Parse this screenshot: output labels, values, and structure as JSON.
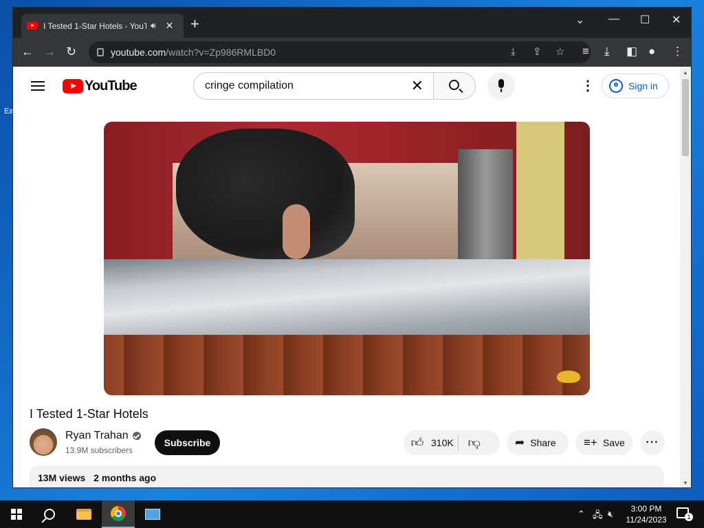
{
  "browser": {
    "tab_title": "I Tested 1-Star Hotels - YouT",
    "audio_icon": "speaker-icon",
    "close_tab": "✕",
    "new_tab": "+",
    "url_host": "youtube.com",
    "url_path": "/watch?v=Zp986RMLBD0"
  },
  "youtube": {
    "logo_text": "YouTube",
    "search_query": "cringe compilation",
    "sign_in": "Sign in",
    "video_title": "I Tested 1-Star Hotels",
    "channel_name": "Ryan Trahan",
    "subscribers": "13.9M subscribers",
    "subscribe": "Subscribe",
    "likes": "310K",
    "share": "Share",
    "save": "Save",
    "views": "13M views",
    "uploaded": "2 months ago"
  },
  "taskbar": {
    "time": "3:00 PM",
    "date": "11/24/2023",
    "notification_count": "1"
  },
  "desktop": {
    "icon_label": "Ea"
  },
  "colors": {
    "youtube_red": "#ff0000",
    "link_blue": "#065fd4",
    "chrome_dark": "#202124"
  }
}
